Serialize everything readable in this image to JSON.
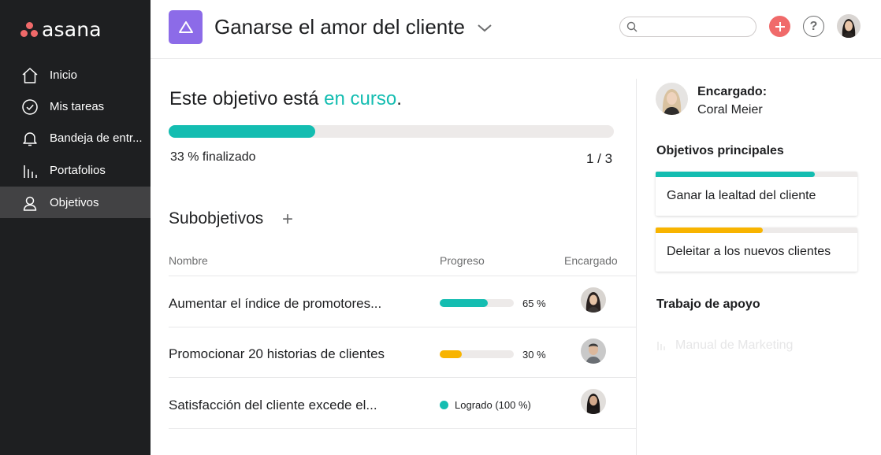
{
  "brand": {
    "name": "asana",
    "dot_color": "#f06a6a"
  },
  "sidebar": {
    "items": [
      {
        "label": "Inicio",
        "icon": "home-icon"
      },
      {
        "label": "Mis tareas",
        "icon": "check-circle-icon"
      },
      {
        "label": "Bandeja de entr...",
        "icon": "bell-icon"
      },
      {
        "label": "Portafolios",
        "icon": "bar-chart-icon"
      },
      {
        "label": "Objetivos",
        "icon": "person-icon",
        "active": true
      }
    ]
  },
  "header": {
    "title": "Ganarse el amor del cliente",
    "project_icon_color": "#8c6be8",
    "search": {
      "placeholder": "",
      "value": ""
    },
    "help_label": "?"
  },
  "status": {
    "prefix": "Este objetivo está ",
    "state": "en curso",
    "suffix": ".",
    "accent": "#14bdb1",
    "progress_percent": 33,
    "progress_text": "33 % finalizado",
    "count_text": "1 / 3"
  },
  "subgoals": {
    "title": "Subobjetivos",
    "add_label": "+",
    "columns": {
      "name": "Nombre",
      "progress": "Progreso",
      "owner": "Encargado"
    },
    "rows": [
      {
        "name": "Aumentar el índice de promotores...",
        "percent": 65,
        "percent_text": "65 %",
        "color": "#14bdb1"
      },
      {
        "name": "Promocionar 20 historias de clientes",
        "percent": 30,
        "percent_text": "30 %",
        "color": "#f8b400"
      },
      {
        "name": "Satisfacción del cliente excede el...",
        "done": true,
        "done_text": "Logrado (100 %)",
        "color": "#14bdb1"
      }
    ]
  },
  "panel": {
    "owner_label": "Encargado:",
    "owner_name": "Coral Meier",
    "parent_goals_title": "Objetivos principales",
    "parent_goals": [
      {
        "label": "Ganar la lealtad del cliente",
        "percent": 79,
        "color": "#14bdb1"
      },
      {
        "label": "Deleitar a los nuevos clientes",
        "percent": 53,
        "color": "#f8b400"
      }
    ],
    "support_title": "Trabajo de apoyo",
    "support_items": [
      {
        "label": "Manual de Marketing",
        "icon": "bar-chart-icon"
      }
    ]
  }
}
